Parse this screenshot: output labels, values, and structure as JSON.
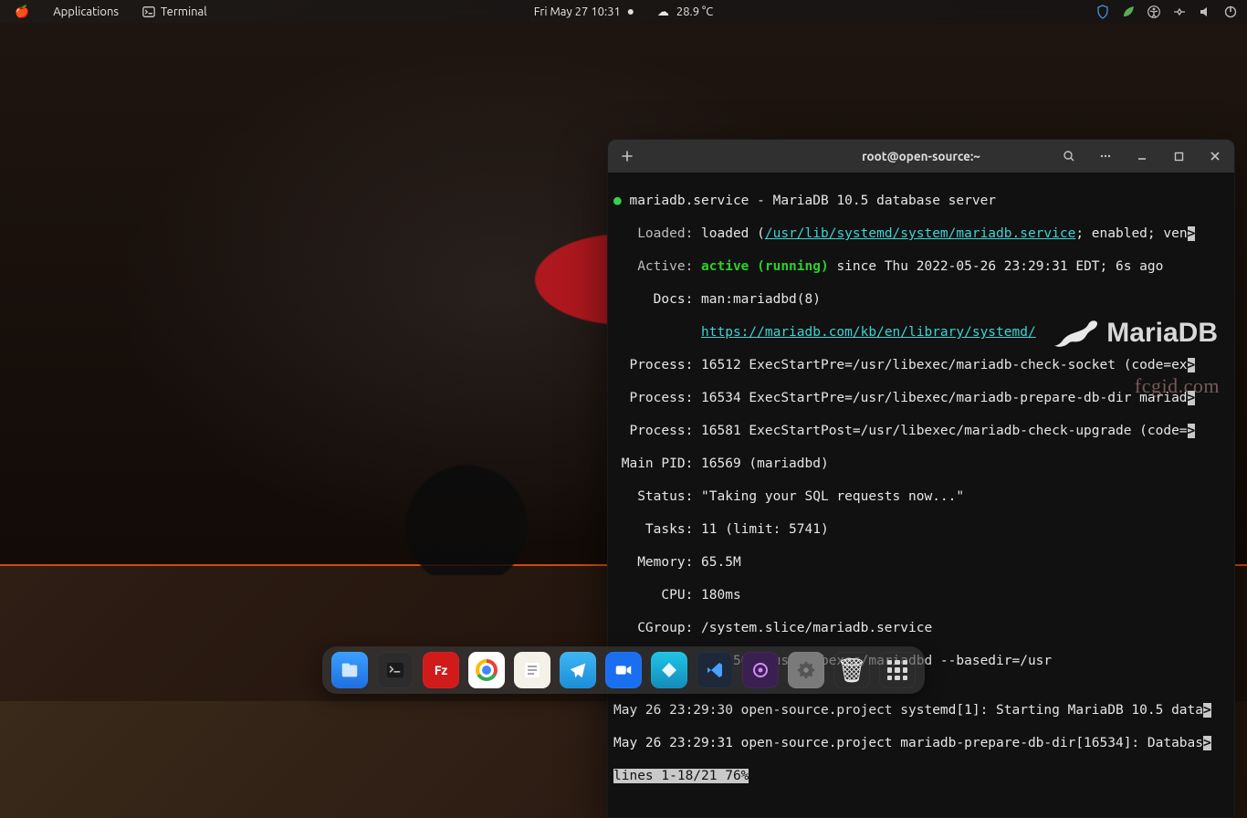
{
  "menubar": {
    "applications_label": "Applications",
    "terminal_label": "Terminal",
    "clock": "Fri May 27  10:31",
    "temperature": "28.9 °C"
  },
  "terminal": {
    "title": "root@open-source:~",
    "bullet": "●",
    "l1_service": "mariadb.service - MariaDB 10.5 database server",
    "l2_label": "   Loaded: ",
    "l2_a": "loaded (",
    "l2_path": "/usr/lib/systemd/system/mariadb.service",
    "l2_b": "; enabled; ven",
    "l3_label": "   Active: ",
    "l3_state": "active (running)",
    "l3_rest": " since Thu 2022-05-26 23:29:31 EDT; 6s ago",
    "l4": "     Docs: man:mariadbd(8)",
    "l5_pad": "           ",
    "l5_url": "https://mariadb.com/kb/en/library/systemd/",
    "l6": "  Process: 16512 ExecStartPre=/usr/libexec/mariadb-check-socket (code=ex",
    "l7": "  Process: 16534 ExecStartPre=/usr/libexec/mariadb-prepare-db-dir mariad",
    "l8": "  Process: 16581 ExecStartPost=/usr/libexec/mariadb-check-upgrade (code=",
    "l9": " Main PID: 16569 (mariadbd)",
    "l10": "   Status: \"Taking your SQL requests now...\"",
    "l11": "    Tasks: 11 (limit: 5741)",
    "l12": "   Memory: 65.5M",
    "l13": "      CPU: 180ms",
    "l14": "   CGroup: /system.slice/mariadb.service",
    "l15": "           └─16569 /usr/libexec/mariadbd --basedir=/usr",
    "l17": "May 26 23:29:30 open-source.project systemd[1]: Starting MariaDB 10.5 data",
    "l18": "May 26 23:29:31 open-source.project mariadb-prepare-db-dir[16534]: Databas",
    "pager": "lines 1-18/21 76%",
    "arrow": ">"
  },
  "branding": {
    "mariadb": "MariaDB",
    "watermark": "fcgid.com"
  },
  "dock": {
    "items": [
      {
        "name": "files"
      },
      {
        "name": "terminal"
      },
      {
        "name": "filezilla"
      },
      {
        "name": "chrome"
      },
      {
        "name": "notes"
      },
      {
        "name": "telegram"
      },
      {
        "name": "zoom"
      },
      {
        "name": "app-blue"
      },
      {
        "name": "vscode"
      },
      {
        "name": "podcast"
      },
      {
        "name": "settings"
      },
      {
        "name": "trash"
      },
      {
        "name": "app-grid"
      }
    ]
  }
}
